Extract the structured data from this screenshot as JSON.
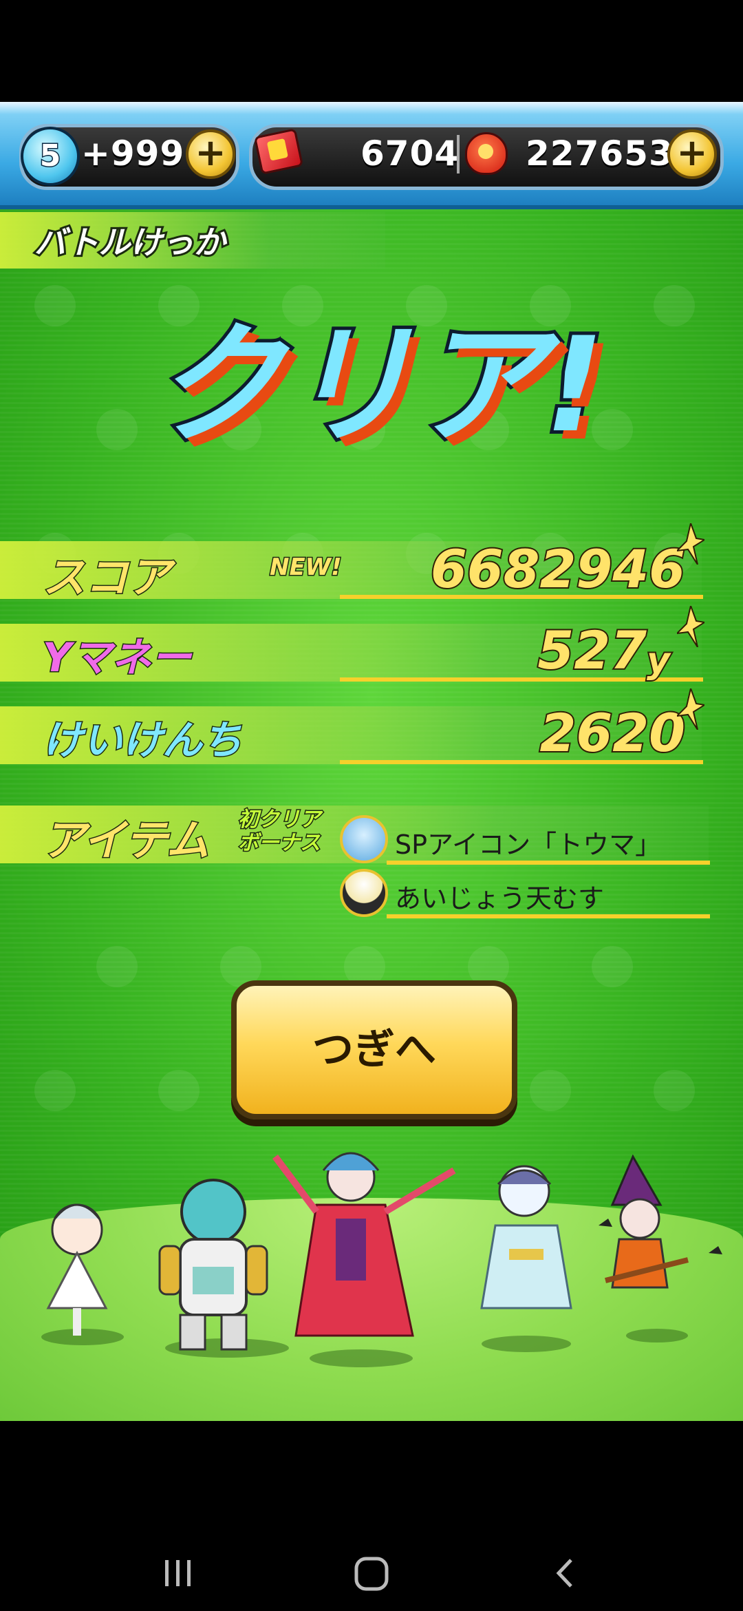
{
  "hud": {
    "level": "5",
    "stamina": "+999",
    "ticket_count": "6704",
    "money": "227653",
    "plus_symbol": "+",
    "colors": {
      "bar": "#3aa9e4",
      "plus": "#f3c533"
    }
  },
  "header": {
    "section_title": "バトルけっか"
  },
  "result": {
    "clear_text": "クリア!"
  },
  "stats": {
    "score_label": "スコア",
    "new_badge": "NEW!",
    "score_value": "6682946",
    "ymoney_label": "Yマネー",
    "ymoney_value": "527",
    "ymoney_unit": "y",
    "exp_label": "けいけんち",
    "exp_value": "2620"
  },
  "items": {
    "label": "アイテム",
    "bonus_line1": "初クリア",
    "bonus_line2": "ボーナス",
    "list": [
      {
        "name": "SPアイコン「トウマ」",
        "icon": "character-portrait-icon"
      },
      {
        "name": "あいじょう天むす",
        "icon": "onigiri-icon"
      }
    ]
  },
  "actions": {
    "next_label": "つぎへ"
  },
  "colors": {
    "field": "#36b21f",
    "accent_line": "#f6d12b",
    "number_fill": "#ffe36a",
    "ymoney_label": "#f06be8",
    "exp_label": "#7fe7ff"
  }
}
